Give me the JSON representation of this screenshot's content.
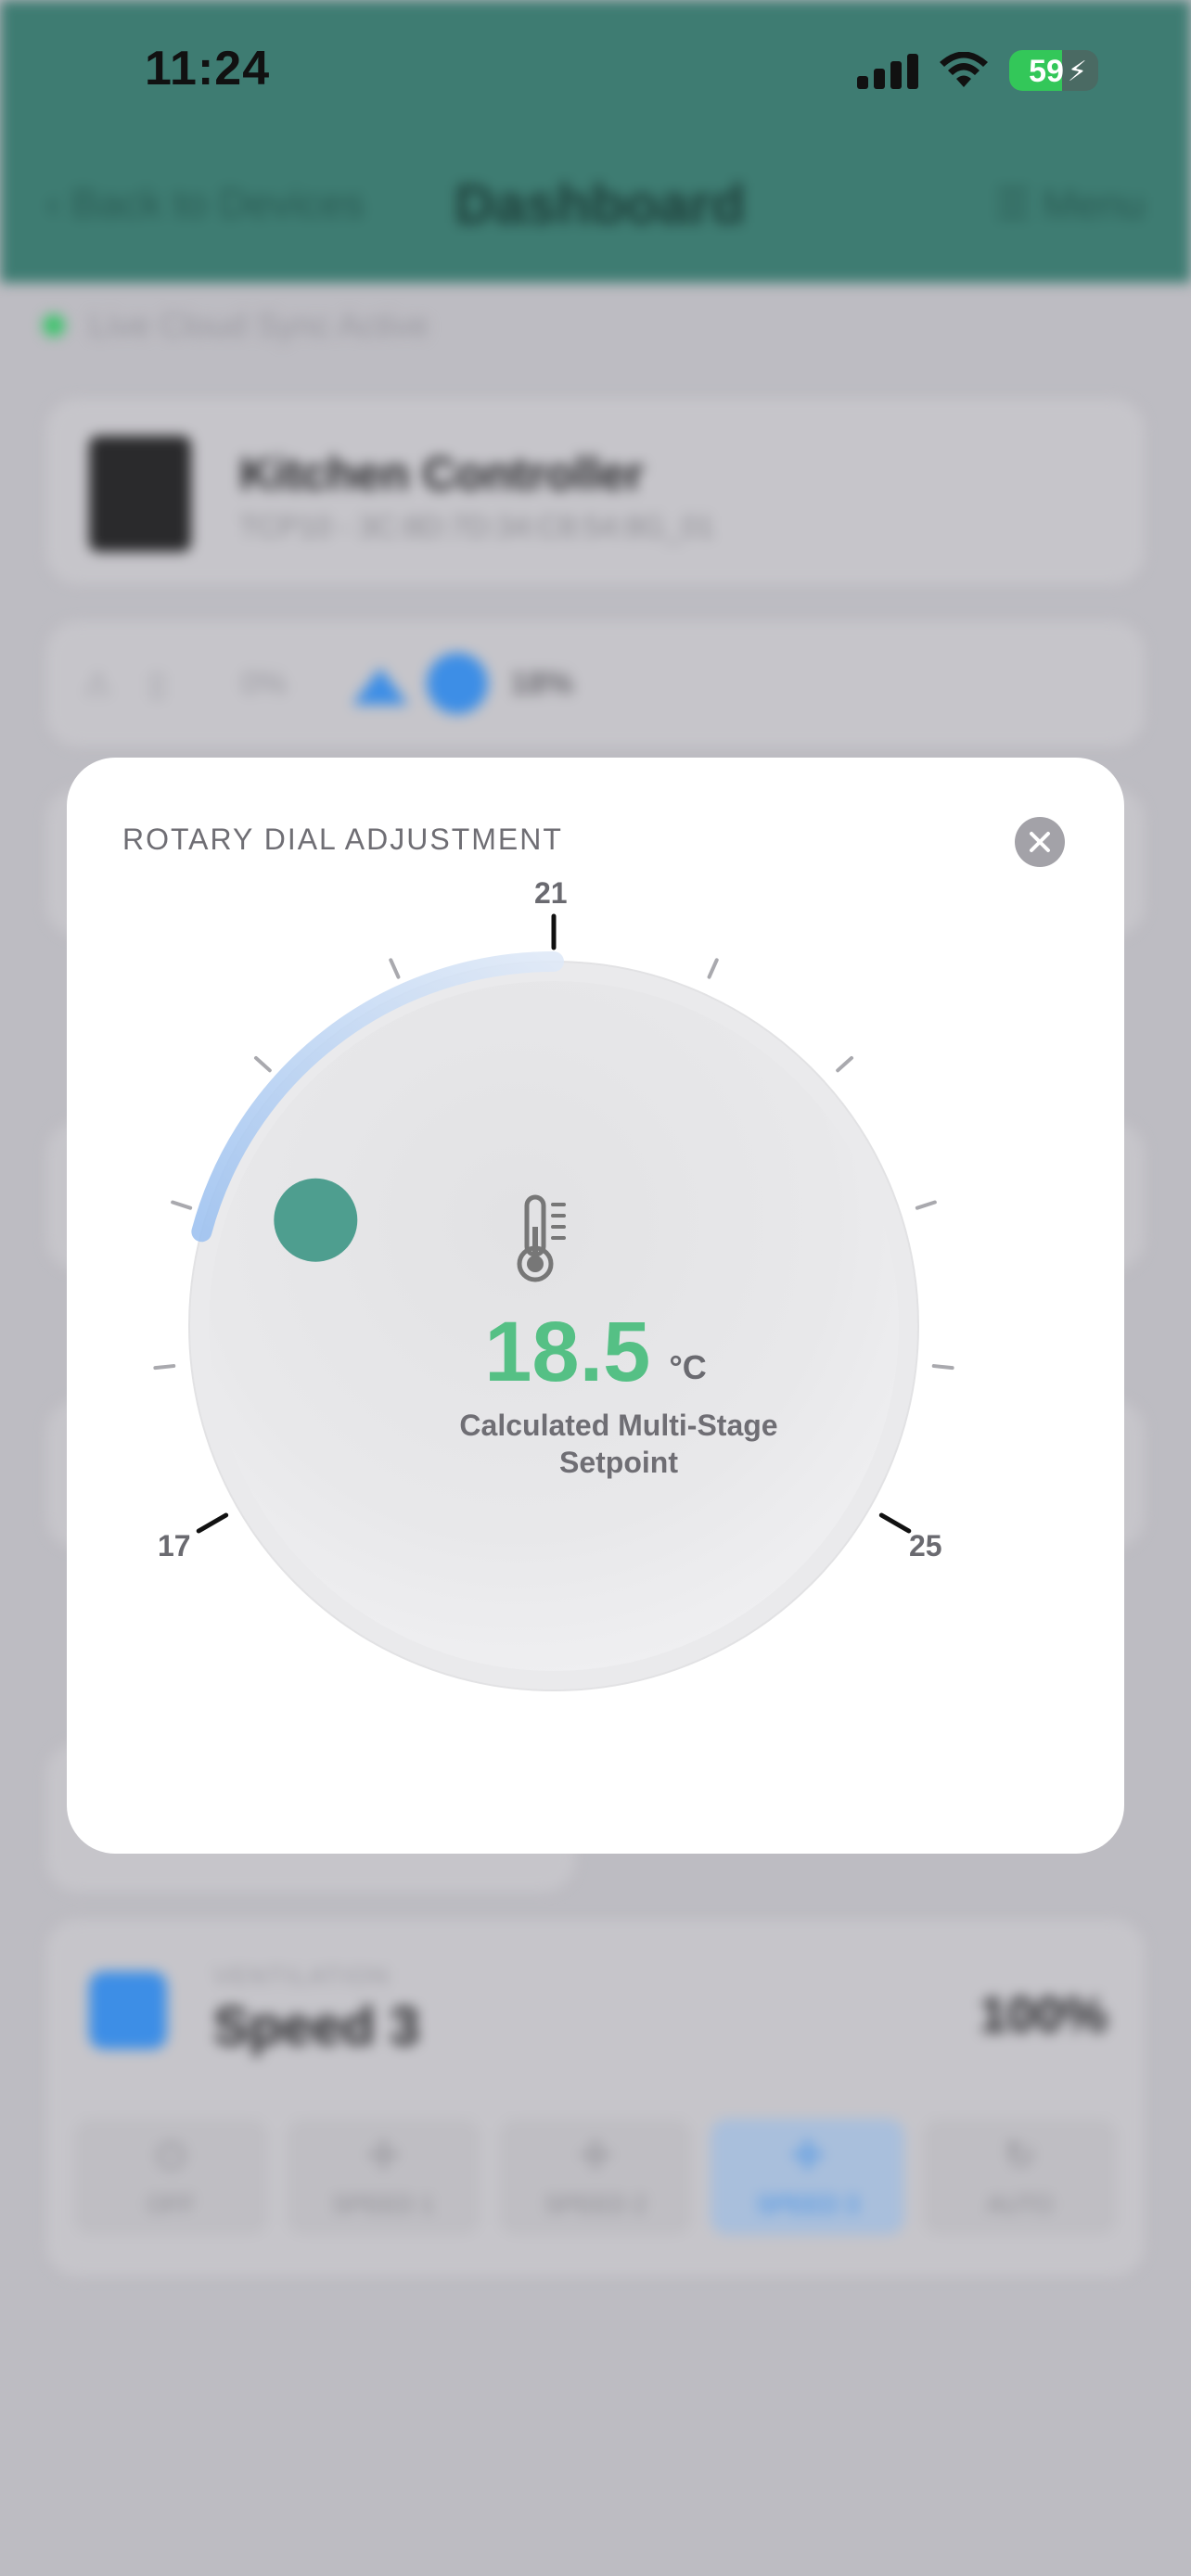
{
  "status_bar": {
    "time": "11:24",
    "battery_percent": "59",
    "battery_charging": true
  },
  "background": {
    "nav": {
      "back_label": "Back to Devices",
      "title": "Dashboard",
      "menu_label": "Menu"
    },
    "sync_status": "Live Cloud Sync Active",
    "device": {
      "name": "Kitchen Controller",
      "id": "TCP10 - 3C:8D:7D:34:C8:54:8G_01"
    },
    "status_row": {
      "item_a_value": "0%",
      "item_b_value": "18%"
    },
    "ventilation": {
      "label": "VENTILATION",
      "speed": "Speed 3",
      "percent": "100%",
      "buttons": [
        {
          "label": "OFF",
          "icon": "power-icon",
          "active": false
        },
        {
          "label": "SPEED 1",
          "icon": "fan-icon",
          "active": false
        },
        {
          "label": "SPEED 2",
          "icon": "fan-icon",
          "active": false
        },
        {
          "label": "SPEED 3",
          "icon": "fan-icon",
          "active": true
        },
        {
          "label": "AUTO",
          "icon": "refresh-icon",
          "active": false
        }
      ]
    }
  },
  "modal": {
    "title": "ROTARY DIAL ADJUSTMENT",
    "dial": {
      "min": 17,
      "max": 25,
      "min_label": "17",
      "max_label": "25",
      "mid_label": "21",
      "value": 18.5,
      "value_text": "18.5",
      "unit": "°C",
      "caption": "Calculated Multi-Stage Setpoint",
      "accent_color": "#55c085",
      "arc_color": "#a8c8f2",
      "knob_color": "#4e9e8f"
    }
  }
}
